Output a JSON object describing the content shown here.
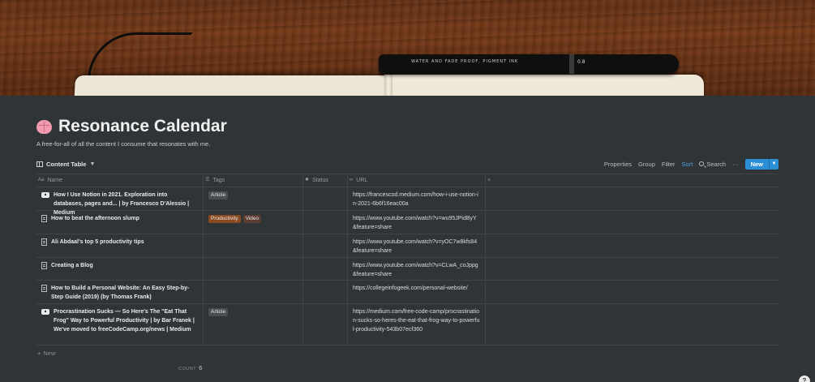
{
  "cover": {
    "pen_text": "WATER AND FADE PROOF, PIGMENT INK",
    "pen_size": "0.8"
  },
  "page": {
    "title": "Resonance Calendar",
    "description": "A free-for-all of all the content I consume that resonates with me."
  },
  "toolbar": {
    "view_label": "Content Table",
    "properties": "Properties",
    "group": "Group",
    "filter": "Filter",
    "sort": "Sort",
    "search": "Search",
    "more": "···",
    "new_label": "New"
  },
  "table": {
    "headers": {
      "name": "Name",
      "tags": "Tags",
      "status": "Status",
      "url": "URL",
      "add": "+"
    },
    "rows": [
      {
        "name": "How I Use Notion in 2021. Exploration into databases, pages and... | by Francesco D'Alessio | Medium",
        "tags": [
          "Article"
        ],
        "url": "https://francescod.medium.com/how-i-use-notion-in-2021-6b6f16eac00a"
      },
      {
        "name": "How to beat the afternoon slump",
        "tags": [
          "Productivity",
          "Video"
        ],
        "url": "https://www.youtube.com/watch?v=wu95JPidByY&feature=share"
      },
      {
        "name": "Ali Abdaal's top 5 productivity tips",
        "tags": [],
        "url": "https://www.youtube.com/watch?v=yOC7w8kfs84&feature=share"
      },
      {
        "name": "Creating a Blog",
        "tags": [],
        "url": "https://www.youtube.com/watch?v=CLwA_coJppg&feature=share"
      },
      {
        "name": "How to Build a Personal Website: An Easy Step-by-Step Guide (2019) (by Thomas Frank)",
        "tags": [],
        "url": "https://collegeinfogeek.com/personal-website/"
      },
      {
        "name": "Procrastination Sucks — So Here's The \"Eat That Frog\" Way to Powerful Productivity | by Bar Franek | We've moved to freeCodeCamp.org/news | Medium",
        "tags": [
          "Article"
        ],
        "url": "https://medium.com/free-code-camp/procrastination-sucks-so-heres-the-eat-that-frog-way-to-powerful-productivity-543b07ecf360"
      }
    ],
    "new_row": "New",
    "count_label": "COUNT",
    "count_value": "6"
  },
  "help": "?"
}
